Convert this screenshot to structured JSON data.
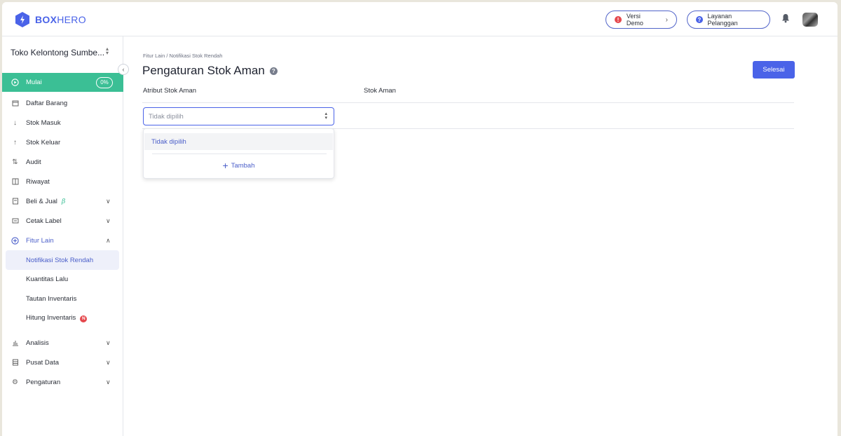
{
  "header": {
    "logo_text_bold": "BOX",
    "logo_text_thin": "HERO",
    "demo_label": "Versi Demo",
    "support_label": "Layanan Pelanggan",
    "brand_color": "#4a63e8"
  },
  "sidebar": {
    "store_name": "Toko Kelontong Sumbe...",
    "items": [
      {
        "label": "Mulai",
        "icon": "play-circle-icon",
        "badge": "0%"
      },
      {
        "label": "Daftar Barang",
        "icon": "box-icon"
      },
      {
        "label": "Stok Masuk",
        "icon": "arrow-down-icon"
      },
      {
        "label": "Stok Keluar",
        "icon": "arrow-up-icon"
      },
      {
        "label": "Audit",
        "icon": "swap-icon"
      },
      {
        "label": "Riwayat",
        "icon": "history-icon"
      },
      {
        "label": "Beli & Jual",
        "icon": "receipt-icon",
        "beta": "β"
      },
      {
        "label": "Cetak Label",
        "icon": "label-icon"
      },
      {
        "label": "Fitur Lain",
        "icon": "plus-circle-icon"
      },
      {
        "label": "Notifikasi Stok Rendah"
      },
      {
        "label": "Kuantitas Lalu"
      },
      {
        "label": "Tautan Inventaris"
      },
      {
        "label": "Hitung Inventaris",
        "new_badge": "N"
      },
      {
        "label": "Analisis",
        "icon": "chart-icon"
      },
      {
        "label": "Pusat Data",
        "icon": "database-icon"
      },
      {
        "label": "Pengaturan",
        "icon": "gear-icon"
      }
    ],
    "active_color": "#3bbf95"
  },
  "main": {
    "breadcrumb": "Fitur Lain / Notifikasi Stok Rendah",
    "title": "Pengaturan Stok Aman",
    "help_glyph": "?",
    "done_button": "Selesai",
    "col_attr": "Atribut Stok Aman",
    "col_stock": "Stok Aman",
    "select_value": "Tidak dipilih",
    "dropdown": {
      "option": "Tidak dipilih",
      "add_label": "Tambah"
    }
  }
}
